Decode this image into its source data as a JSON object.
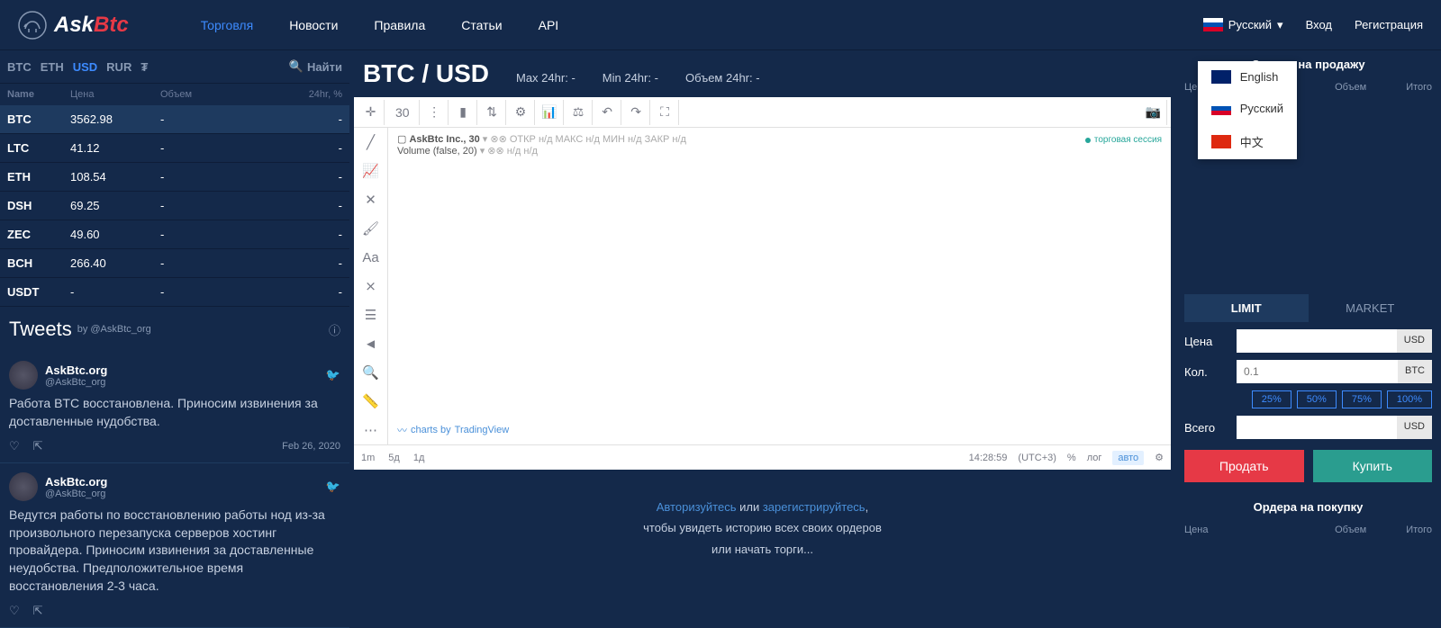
{
  "header": {
    "logo_ask": "Ask",
    "logo_btc": "Btc",
    "nav": [
      {
        "label": "Торговля",
        "active": true
      },
      {
        "label": "Новости"
      },
      {
        "label": "Правила"
      },
      {
        "label": "Статьи"
      },
      {
        "label": "API"
      }
    ],
    "language": "Русский",
    "login": "Вход",
    "register": "Регистрация",
    "lang_options": [
      {
        "label": "English",
        "flag": "en"
      },
      {
        "label": "Русский",
        "flag": "ru"
      },
      {
        "label": "中文",
        "flag": "cn"
      }
    ]
  },
  "currency_tabs": [
    "BTC",
    "ETH",
    "USD",
    "RUR",
    "₮"
  ],
  "currency_active": "USD",
  "search_placeholder": "Найти",
  "price_headers": {
    "name": "Name",
    "price": "Цена",
    "volume": "Объем",
    "change": "24hr, %"
  },
  "price_rows": [
    {
      "name": "BTC",
      "price": "3562.98",
      "vol": "-",
      "change": "-",
      "selected": true
    },
    {
      "name": "LTC",
      "price": "41.12",
      "vol": "-",
      "change": "-"
    },
    {
      "name": "ETH",
      "price": "108.54",
      "vol": "-",
      "change": "-"
    },
    {
      "name": "DSH",
      "price": "69.25",
      "vol": "-",
      "change": "-"
    },
    {
      "name": "ZEC",
      "price": "49.60",
      "vol": "-",
      "change": "-"
    },
    {
      "name": "BCH",
      "price": "266.40",
      "vol": "-",
      "change": "-"
    },
    {
      "name": "USDT",
      "price": "-",
      "vol": "-",
      "change": "-"
    }
  ],
  "tweets": {
    "title": "Tweets",
    "by": "by @AskBtc_org",
    "items": [
      {
        "name": "AskBtc.org",
        "handle": "@AskBtc_org",
        "body": "Работа BTC восстановлена. Приносим извинения за доставленные нудобства.",
        "date": "Feb 26, 2020"
      },
      {
        "name": "AskBtc.org",
        "handle": "@AskBtc_org",
        "body": "Ведутся работы по восстановлению работы нод из-за произвольного перезапуска серверов хостинг провайдера. Приносим извинения за доставленные неудобства. Предположительное время восстановления 2-3 часа.",
        "date": ""
      }
    ]
  },
  "pair": {
    "title": "BTC / USD",
    "max_label": "Max 24hr:",
    "max_val": "-",
    "min_label": "Min 24hr:",
    "min_val": "-",
    "vol_label": "Объем 24hr:",
    "vol_val": "-"
  },
  "chart": {
    "interval": "30",
    "symbol": "AskBtc Inc., 30",
    "ohlc": "ОТКР н/д МАКС н/д МИН н/д ЗАКР н/д",
    "volume": "Volume (false, 20)",
    "volume_vals": "н/д н/д",
    "session": "торговая сессия",
    "credit_text": "charts by",
    "credit_link": "TradingView",
    "timeframes": [
      "1m",
      "5д",
      "1д"
    ],
    "time": "14:28:59",
    "tz": "(UTC+3)",
    "footer_items": [
      "%",
      "лог"
    ],
    "auto": "авто"
  },
  "auth_prompt": {
    "login": "Авторизуйтесь",
    "or": " или ",
    "register": "зарегистрируйтесь",
    "comma": ",",
    "line2": "чтобы увидеть историю всех своих ордеров",
    "line3": "или начать торги..."
  },
  "orders": {
    "sell_title": "Ордера на продажу",
    "buy_title": "Ордера на покупку",
    "cols": {
      "price": "Цена",
      "volume": "Объем",
      "total": "Итого"
    }
  },
  "order_form": {
    "tabs": {
      "limit": "LIMIT",
      "market": "MARKET"
    },
    "price_label": "Цена",
    "qty_label": "Кол.",
    "qty_placeholder": "0.1",
    "total_label": "Всего",
    "usd": "USD",
    "btc": "BTC",
    "pcts": [
      "25%",
      "50%",
      "75%",
      "100%"
    ],
    "sell": "Продать",
    "buy": "Купить"
  }
}
